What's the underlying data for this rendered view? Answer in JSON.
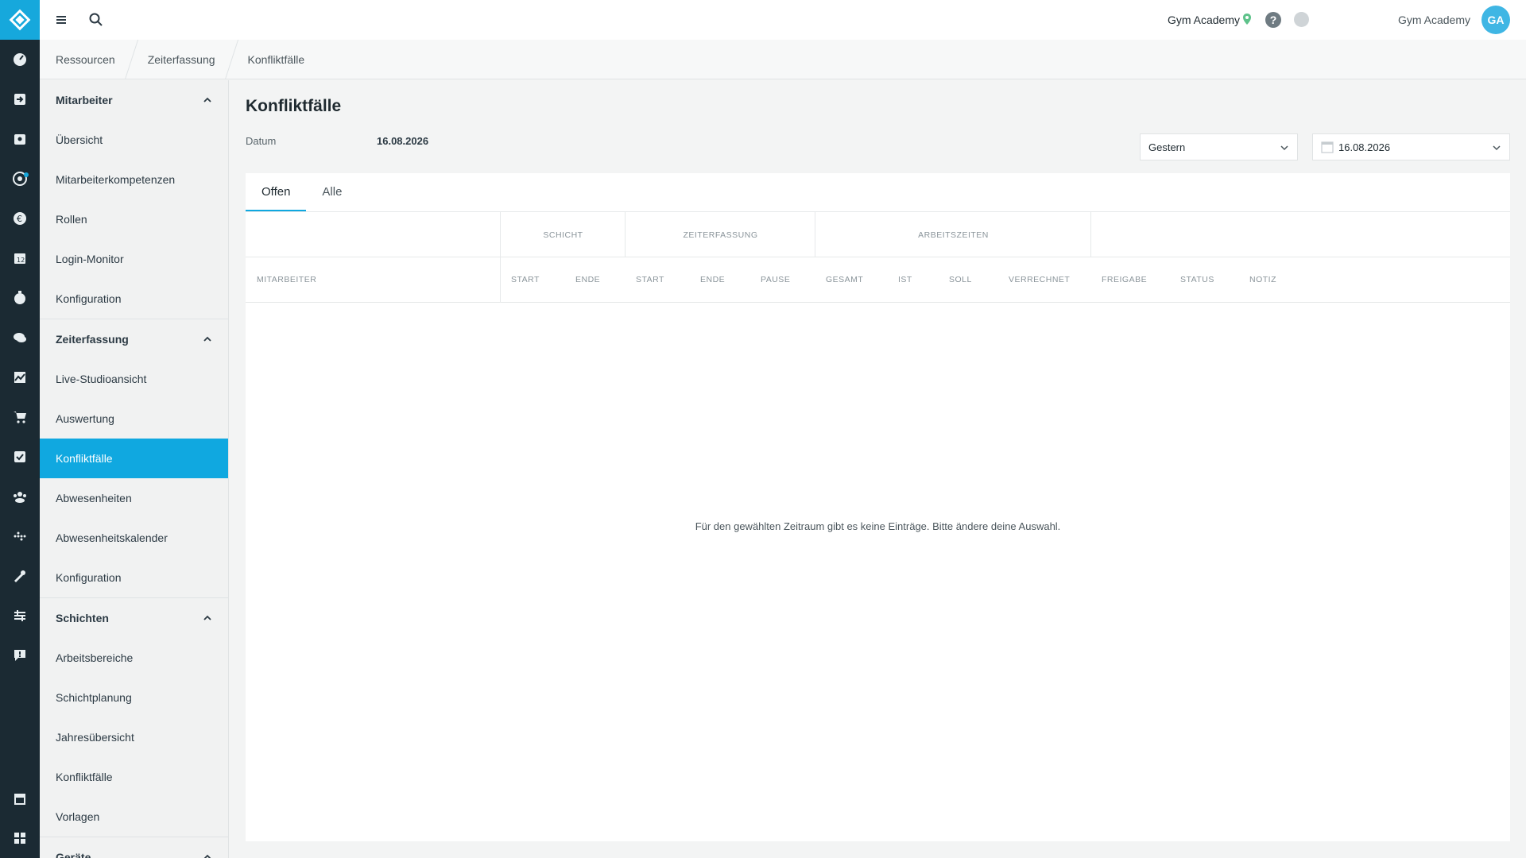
{
  "app": {
    "studio_name": "Gym Academy",
    "user_name": "Gym Academy",
    "user_initials": "GA",
    "accent": "#10a8e0"
  },
  "rail": {
    "icons": [
      "dashboard-icon",
      "checkin-icon",
      "contacts-icon",
      "target-icon",
      "euro-icon",
      "calendar-icon",
      "timer-icon",
      "chat-icon",
      "chart-icon",
      "cart-icon",
      "tasks-icon",
      "staff-icon",
      "devices-icon",
      "tools-icon",
      "settings-sliders-icon",
      "feedback-icon",
      "store-icon",
      "apps-icon"
    ]
  },
  "breadcrumb": [
    "Ressourcen",
    "Zeiterfassung",
    "Konfliktfälle"
  ],
  "submenu": {
    "sections": [
      {
        "title": "Mitarbeiter",
        "items": [
          "Übersicht",
          "Mitarbeiterkompetenzen",
          "Rollen",
          "Login-Monitor",
          "Konfiguration"
        ]
      },
      {
        "title": "Zeiterfassung",
        "items": [
          "Live-Studioansicht",
          "Auswertung",
          "Konfliktfälle",
          "Abwesenheiten",
          "Abwesenheitskalender",
          "Konfiguration"
        ]
      },
      {
        "title": "Schichten",
        "items": [
          "Arbeitsbereiche",
          "Schichtplanung",
          "Jahresübersicht",
          "Konfliktfälle",
          "Vorlagen"
        ]
      },
      {
        "title": "Geräte",
        "items": []
      }
    ],
    "active": "Zeiterfassung/Konfliktfälle"
  },
  "main": {
    "title": "Konfliktfälle",
    "date_label": "Datum",
    "date_value": "16.08.2026",
    "period_select": "Gestern",
    "date_picker": "16.08.2026",
    "tabs": [
      "Offen",
      "Alle"
    ],
    "active_tab": "Offen",
    "groups": [
      "SCHICHT",
      "ZEITERFASSUNG",
      "ARBEITSZEITEN"
    ],
    "columns": [
      "MITARBEITER",
      "START",
      "ENDE",
      "START",
      "ENDE",
      "PAUSE",
      "GESAMT",
      "IST",
      "SOLL",
      "VERRECHNET",
      "FREIGABE",
      "STATUS",
      "NOTIZ"
    ],
    "empty_message": "Für den gewählten Zeitraum gibt es keine Einträge. Bitte ändere deine Auswahl."
  }
}
